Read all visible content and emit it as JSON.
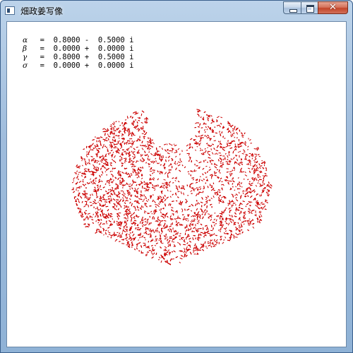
{
  "window": {
    "title": "畑政姜写像",
    "buttons": {
      "minimize": "minimize",
      "maximize": "maximize",
      "close": "✕"
    }
  },
  "params": [
    {
      "symbol": "α",
      "value": "  =  0.8000 -  0.5000 i"
    },
    {
      "symbol": "β",
      "value": "  =  0.0000 +  0.0000 i"
    },
    {
      "symbol": "γ",
      "value": "  =  0.8000 +  0.5000 i"
    },
    {
      "symbol": "σ",
      "value": "  =  0.0000 +  0.0000 i"
    }
  ],
  "figure": {
    "shape": "heart-like point cloud",
    "point_color": "#cc0000",
    "background": "#ffffff"
  }
}
